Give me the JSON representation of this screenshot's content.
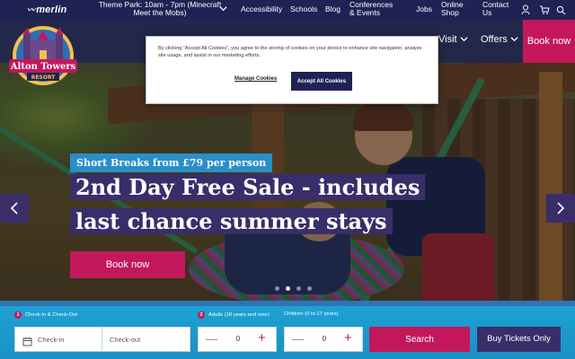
{
  "topbar": {
    "brand": "merlin",
    "hours": "Theme Park: 10am - 7pm (Minecraft Meet the Mobs)",
    "links": {
      "accessibility": "Accessibility",
      "schools": "Schools",
      "blog": "Blog",
      "conferences": "Conferences & Events",
      "jobs": "Jobs",
      "shop": "Online Shop",
      "contact": "Contact Us"
    },
    "icons": [
      "user-icon",
      "cart-icon",
      "search-icon"
    ]
  },
  "nav": {
    "visit": "Visit",
    "offers": "Offers",
    "book_now": "Book now"
  },
  "logo": {
    "line1": "Alton Towers",
    "line2": "RESORT"
  },
  "hero": {
    "tagline": "Short Breaks from £79 per person",
    "headline": "2nd Day Free Sale - includes last chance summer stays",
    "cta": "Book now",
    "slide_count": 4,
    "active_slide": 2
  },
  "cookie": {
    "text": "By clicking “Accept All Cookies”, you agree to the storing of cookies on your device to enhance site navigation, analyze site usage, and assist in our marketing efforts.",
    "manage": "Manage Cookies",
    "accept": "Accept All Cookies"
  },
  "booking": {
    "step1_num": "1",
    "step1_label": "Check-In & Check-Out",
    "step2_num": "2",
    "adults_label": "Adults (18 years and over)",
    "children_label": "Children (0 to 17 years)",
    "checkin_placeholder": "Check-in",
    "checkout_placeholder": "Check-out",
    "adults_value": "0",
    "children_value": "0",
    "search": "Search",
    "buy_tickets": "Buy Tickets Only"
  },
  "colors": {
    "navy": "#1e2354",
    "pink": "#c2185b",
    "purple": "#3a2e6a",
    "blue": "#2b8fc7"
  }
}
